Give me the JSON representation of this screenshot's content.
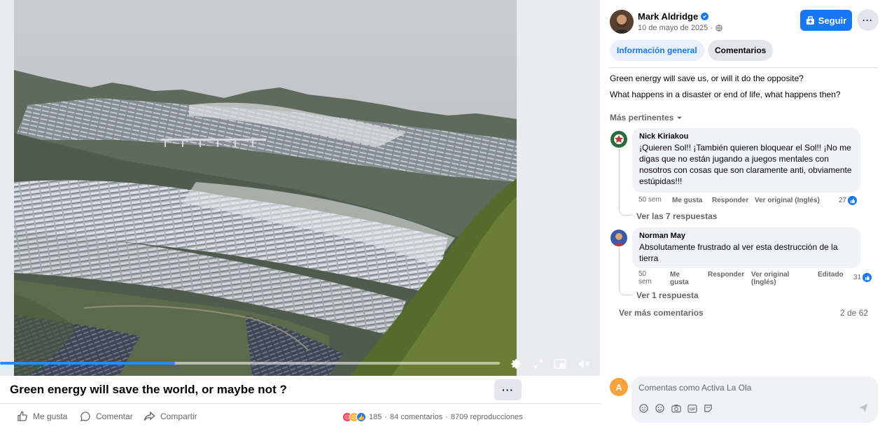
{
  "video": {
    "title": "Green energy will save the world, or maybe not ?",
    "progress": 0.35,
    "more_label": "···"
  },
  "actions": {
    "like": "Me gusta",
    "comment": "Comentar",
    "share": "Compartir"
  },
  "stats": {
    "reactions": "185",
    "comments": "84 comentarios",
    "separator": "·",
    "views": "8709 reproducciones"
  },
  "post": {
    "author": "Mark Aldridge",
    "date": "10 de mayo de 2025 ·",
    "follow_label": "Seguir",
    "tabs": [
      "Información general",
      "Comentarios"
    ],
    "text_lines": [
      "Green energy will save us, or will it do the opposite?",
      "What happens in a disaster or end of life, what happens then?"
    ]
  },
  "comments_section": {
    "sort_label": "Más pertinentes",
    "items": [
      {
        "author": "Nick Kiriakou",
        "text": "¡Quieren Sol!! ¡También quieren bloquear el Sol!! ¡No me digas que no están jugando a juegos mentales con nosotros con cosas que son claramente anti, obviamente estúpidas!!!",
        "time": "50 sem",
        "like": "Me gusta",
        "reply": "Responder",
        "original": "Ver original (Inglés)",
        "likes": "27",
        "replies": "Ver las 7 respuestas"
      },
      {
        "author": "Norman May",
        "text": "Absolutamente frustrado al ver esta destrucción de la tierra",
        "time": "50 sem",
        "like": "Me gusta",
        "reply": "Responder",
        "original": "Ver original (Inglés)",
        "edited": "Editado",
        "likes": "31",
        "replies": "Ver 1 respuesta"
      }
    ],
    "more_label": "Ver más comentarios",
    "page_count": "2 de 62"
  },
  "composer": {
    "avatar_letter": "A",
    "placeholder": "Comentas como Activa La Ola"
  },
  "colors": {
    "accent": "#1877f2",
    "muted": "#65676b",
    "bubble": "#f0f2f5"
  },
  "icons": [
    "verified-icon",
    "globe-icon",
    "follow-icon",
    "settings-icon",
    "fullscreen-icon",
    "pip-icon",
    "mute-icon",
    "like-icon",
    "comment-icon",
    "share-icon",
    "sticker-icon",
    "emoji-icon",
    "camera-icon",
    "gif-icon",
    "send-icon"
  ]
}
